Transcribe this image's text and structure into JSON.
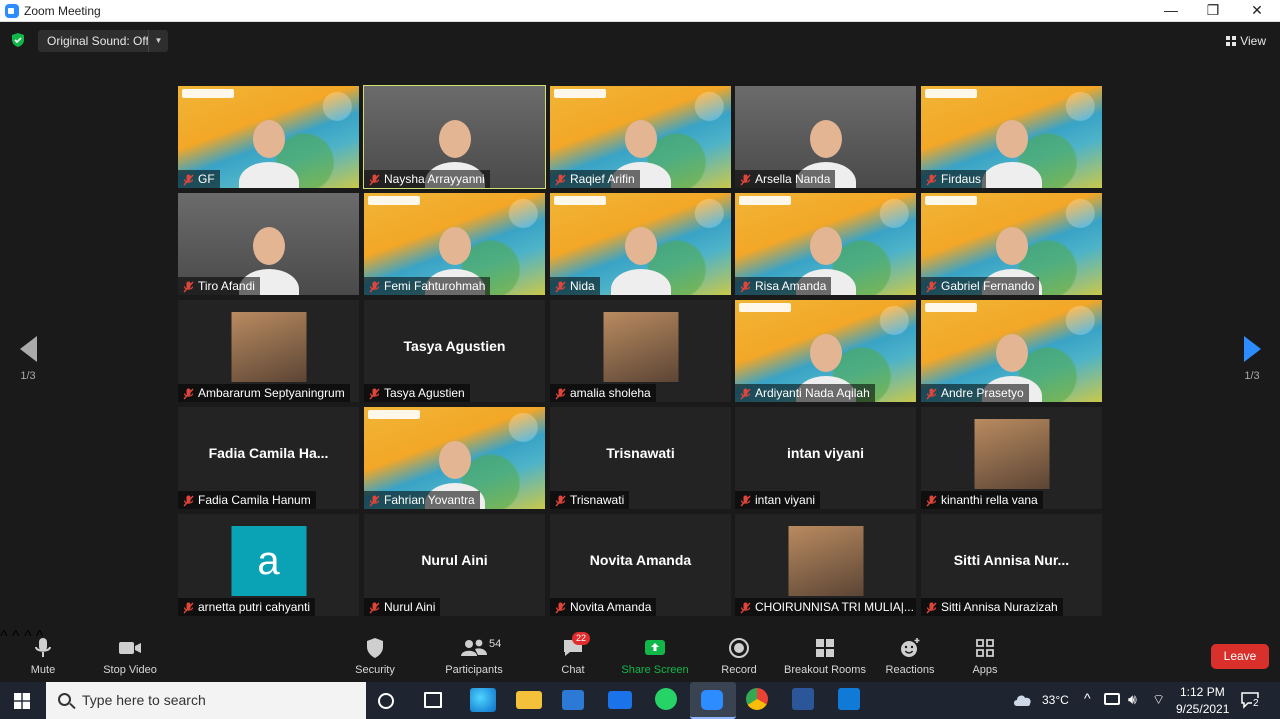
{
  "window": {
    "title": "Zoom Meeting",
    "minimize": "—",
    "maximize": "❐",
    "close": "✕"
  },
  "topbar": {
    "original_sound": "Original Sound: Off",
    "view": "View"
  },
  "pagination": {
    "left": "1/3",
    "right": "1/3"
  },
  "tiles": [
    {
      "name": "GF",
      "type": "vbg",
      "active": false
    },
    {
      "name": "Naysha Arrayyanni",
      "type": "cam",
      "active": true
    },
    {
      "name": "Raqief Arifin",
      "type": "vbg",
      "active": false
    },
    {
      "name": "Arsella Nanda",
      "type": "cam",
      "active": false
    },
    {
      "name": "Firdaus",
      "type": "vbg",
      "active": false
    },
    {
      "name": "Tiro Afandi",
      "type": "cam",
      "active": false
    },
    {
      "name": "Femi Fahturohmah",
      "type": "vbg",
      "active": false
    },
    {
      "name": "Nida",
      "type": "vbg",
      "active": false
    },
    {
      "name": "Risa Amanda",
      "type": "vbg",
      "active": false
    },
    {
      "name": "Gabriel Fernando",
      "type": "vbg",
      "active": false
    },
    {
      "name": "Ambararum Septyaningrum",
      "type": "pic",
      "active": false
    },
    {
      "name": "Tasya Agustien",
      "type": "text",
      "display": "Tasya Agustien",
      "active": false
    },
    {
      "name": "amalia sholeha",
      "type": "pic",
      "active": false
    },
    {
      "name": "Ardiyanti Nada Aqilah",
      "type": "vbg",
      "active": false
    },
    {
      "name": "Andre Prasetyo",
      "type": "vbg",
      "active": false
    },
    {
      "name": "Fadia Camila Hanum",
      "type": "text",
      "display": "Fadia  Camila  Ha...",
      "active": false
    },
    {
      "name": "Fahrian Yovantra",
      "type": "vbg",
      "active": false
    },
    {
      "name": "Trisnawati",
      "type": "text",
      "display": "Trisnawati",
      "active": false
    },
    {
      "name": "intan viyani",
      "type": "text",
      "display": "intan viyani",
      "active": false
    },
    {
      "name": "kinanthi rella vana",
      "type": "pic",
      "active": false
    },
    {
      "name": "arnetta putri cahyanti",
      "type": "pic",
      "avatar_letter": "a",
      "active": false
    },
    {
      "name": "Nurul Aini",
      "type": "text",
      "display": "Nurul Aini",
      "active": false
    },
    {
      "name": "Novita Amanda",
      "type": "text",
      "display": "Novita Amanda",
      "active": false
    },
    {
      "name": "CHOIRUNNISA TRI MULIA|...",
      "type": "pic",
      "active": false
    },
    {
      "name": "Sitti Annisa Nurazizah",
      "type": "text",
      "display": "Sitti  Annisa  Nur...",
      "active": false
    }
  ],
  "toolbar": {
    "mute": "Mute",
    "stop_video": "Stop Video",
    "security": "Security",
    "participants": "Participants",
    "participants_count": "54",
    "chat": "Chat",
    "chat_badge": "22",
    "share_screen": "Share Screen",
    "record": "Record",
    "breakout_rooms": "Breakout Rooms",
    "reactions": "Reactions",
    "apps": "Apps",
    "leave": "Leave"
  },
  "taskbar": {
    "search_placeholder": "Type here to search",
    "temperature": "33°C",
    "time": "1:12 PM",
    "date": "9/25/2021",
    "notifications": "2"
  },
  "colors": {
    "accent_green": "#12b74a",
    "leave_red": "#d9302c",
    "active_outline": "#d2df6e",
    "nav_blue": "#2d8cff"
  }
}
